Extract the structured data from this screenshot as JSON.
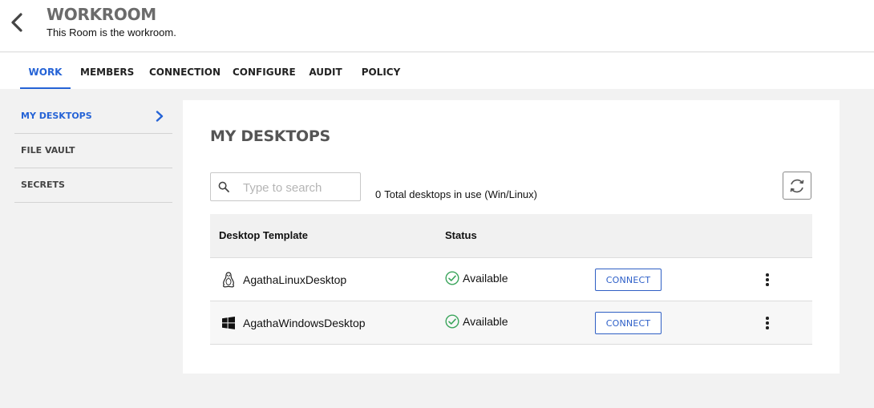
{
  "header": {
    "title": "WORKROOM",
    "description": "This Room is the workroom."
  },
  "tabs": [
    {
      "label": "WORK",
      "active": true
    },
    {
      "label": "MEMBERS",
      "active": false
    },
    {
      "label": "CONNECTION",
      "active": false
    },
    {
      "label": "CONFIGURE",
      "active": false
    },
    {
      "label": "AUDIT",
      "active": false
    },
    {
      "label": "POLICY",
      "active": false
    }
  ],
  "sidebar": {
    "items": [
      {
        "label": "MY DESKTOPS",
        "active": true
      },
      {
        "label": "FILE VAULT",
        "active": false
      },
      {
        "label": "SECRETS",
        "active": false
      }
    ]
  },
  "main": {
    "title": "MY DESKTOPS",
    "search": {
      "placeholder": "Type to search",
      "value": ""
    },
    "total": {
      "count": "0",
      "label": "Total desktops in use (Win/Linux)"
    },
    "table": {
      "columns": [
        "Desktop Template",
        "Status"
      ],
      "rows": [
        {
          "os_icon": "linux-icon",
          "name": "AgathaLinuxDesktop",
          "status": "Available",
          "action": "CONNECT"
        },
        {
          "os_icon": "windows-icon",
          "name": "AgathaWindowsDesktop",
          "status": "Available",
          "action": "CONNECT"
        }
      ]
    }
  },
  "colors": {
    "accent": "#2563d6",
    "status_ok": "#3ba55c"
  }
}
